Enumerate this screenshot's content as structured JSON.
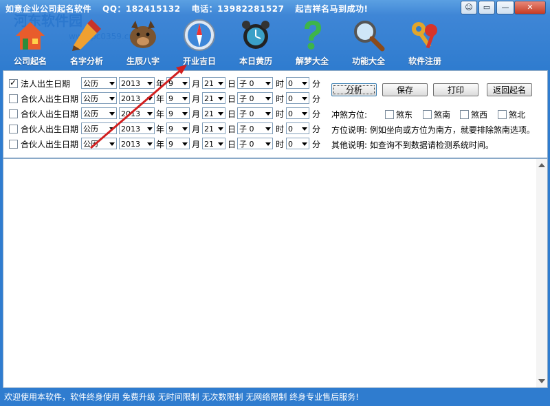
{
  "window": {
    "title_app": "如意企业公司起名软件",
    "title_qq": "QQ：182415132",
    "title_phone": "电话：13982281527",
    "title_slogan": "起吉祥名马到成功!",
    "controls": [
      "☺",
      "▭",
      "—",
      "✕"
    ]
  },
  "watermark": {
    "line1": "河东软件园",
    "line2": "www.pc0359.cn"
  },
  "toolbar": [
    {
      "label": "公司起名",
      "icon": "house-icon"
    },
    {
      "label": "名字分析",
      "icon": "pencil-icon"
    },
    {
      "label": "生辰八字",
      "icon": "boar-icon"
    },
    {
      "label": "开业吉日",
      "icon": "compass-icon"
    },
    {
      "label": "本日黄历",
      "icon": "alarm-clock-icon"
    },
    {
      "label": "解梦大全",
      "icon": "question-icon"
    },
    {
      "label": "功能大全",
      "icon": "magnifier-icon"
    },
    {
      "label": "软件注册",
      "icon": "keys-icon"
    }
  ],
  "form": {
    "rows": [
      {
        "label": "法人出生日期",
        "checked": true,
        "calendar": "公历",
        "year": "2013",
        "month": "9",
        "day": "21",
        "hour_branch": "子",
        "hour": "0",
        "minute": "0"
      },
      {
        "label": "合伙人出生日期",
        "checked": false,
        "calendar": "公历",
        "year": "2013",
        "month": "9",
        "day": "21",
        "hour_branch": "子",
        "hour": "0",
        "minute": "0"
      },
      {
        "label": "合伙人出生日期",
        "checked": false,
        "calendar": "公历",
        "year": "2013",
        "month": "9",
        "day": "21",
        "hour_branch": "子",
        "hour": "0",
        "minute": "0"
      },
      {
        "label": "合伙人出生日期",
        "checked": false,
        "calendar": "公历",
        "year": "2013",
        "month": "9",
        "day": "21",
        "hour_branch": "子",
        "hour": "0",
        "minute": "0"
      },
      {
        "label": "合伙人出生日期",
        "checked": false,
        "calendar": "公历",
        "year": "2013",
        "month": "9",
        "day": "21",
        "hour_branch": "子",
        "hour": "0",
        "minute": "0"
      }
    ],
    "units": {
      "year": "年",
      "month": "月",
      "day": "日",
      "hour": "时",
      "minute": "分"
    }
  },
  "buttons": {
    "analyze": "分析",
    "save": "保存",
    "print": "打印",
    "back": "返回起名"
  },
  "direction": {
    "label": "冲煞方位:",
    "options": [
      "煞东",
      "煞南",
      "煞西",
      "煞北"
    ],
    "explain": "方位说明: 例如坐向或方位为南方，就要排除煞南选项。",
    "other": "其他说明: 如查询不到数据请检测系统时间。"
  },
  "status_text": "欢迎使用本软件，软件终身使用  免费升级  无时间限制  无次数限制  无网络限制  终身专业售后服务!",
  "colors": {
    "title_bg": "#3f86d6",
    "arrow": "#d11f1f"
  }
}
